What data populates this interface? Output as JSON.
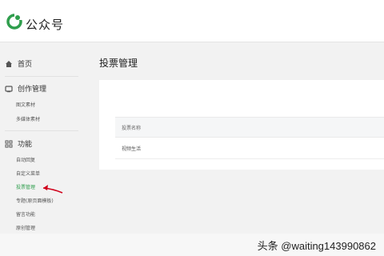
{
  "header": {
    "brand": "公众号"
  },
  "sidebar": {
    "home": "首页",
    "create": {
      "title": "创作管理",
      "items": [
        "图文素材",
        "多媒体素材"
      ]
    },
    "features": {
      "title": "功能",
      "items": [
        "自动回复",
        "自定义菜单",
        "投票管理",
        "专题(原页面模板)",
        "留言功能",
        "原创管理"
      ],
      "active_index": 2
    }
  },
  "main": {
    "title": "投票管理",
    "table": {
      "header": "投票名称",
      "rows": [
        "视频生活"
      ]
    }
  },
  "watermark": "头条 @waiting143990862",
  "colors": {
    "brand_green": "#2f9e4d",
    "arrow_red": "#d0021b"
  }
}
